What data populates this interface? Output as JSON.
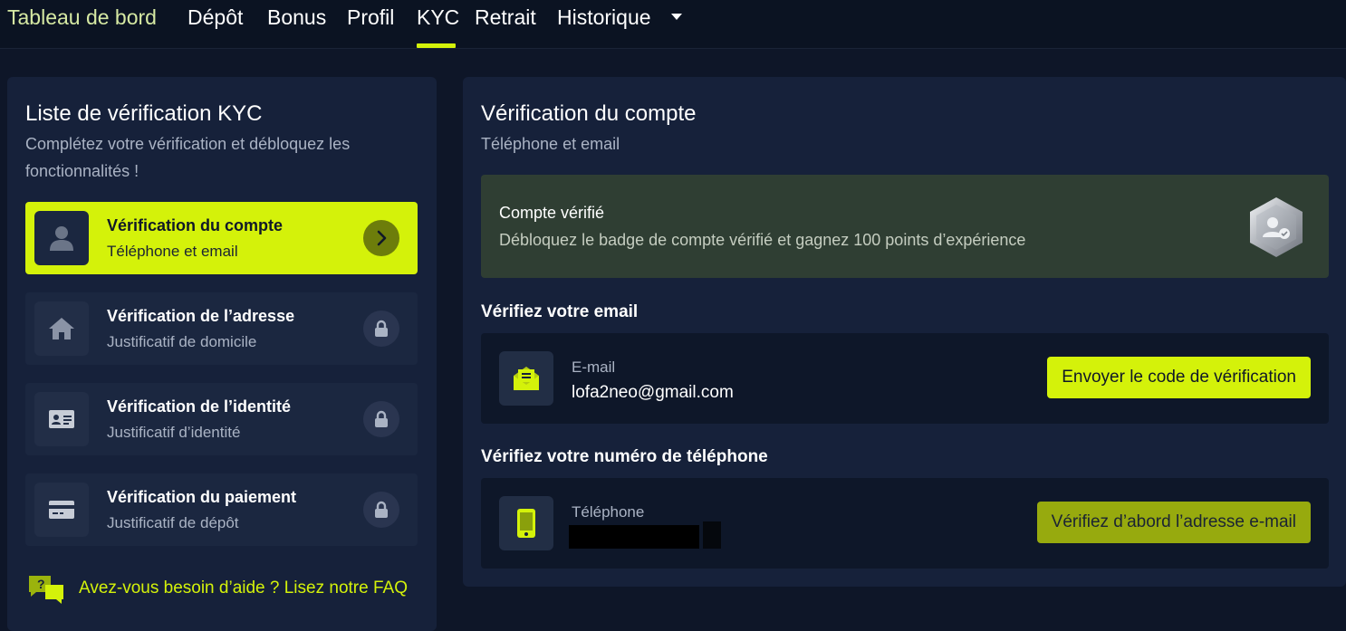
{
  "nav": {
    "items": [
      {
        "label": "Tableau de bord"
      },
      {
        "label": "Dépôt"
      },
      {
        "label": "Bonus"
      },
      {
        "label": "Profil"
      },
      {
        "label": "KYC"
      },
      {
        "label": "Retrait"
      },
      {
        "label": "Historique"
      }
    ],
    "active": "KYC",
    "accent_color": "#d4f20a"
  },
  "checklist": {
    "title": "Liste de vérification KYC",
    "subtitle": "Complétez votre vérification et débloquez les fonctionnalités !",
    "items": [
      {
        "title": "Vérification du compte",
        "desc": "Téléphone et email",
        "icon": "user-icon",
        "state": "active"
      },
      {
        "title": "Vérification de l’adresse",
        "desc": "Justificatif de domicile",
        "icon": "home-icon",
        "state": "locked"
      },
      {
        "title": "Vérification de l’identité",
        "desc": "Justificatif d’identité",
        "icon": "id-card-icon",
        "state": "locked"
      },
      {
        "title": "Vérification du paiement",
        "desc": "Justificatif de dépôt",
        "icon": "credit-card-icon",
        "state": "locked"
      }
    ],
    "help": "Avez-vous besoin d’aide ? Lisez notre FAQ"
  },
  "account": {
    "title": "Vérification du compte",
    "subtitle": "Téléphone et email",
    "banner": {
      "title": "Compte vérifié",
      "desc": "Débloquez le badge de compte vérifié et gagnez 100 points d’expérience"
    },
    "email": {
      "section_title": "Vérifiez votre email",
      "label": "E-mail",
      "value": "lofa2neo@gmail.com",
      "button": "Envoyer le code de vérification"
    },
    "phone": {
      "section_title": "Vérifiez votre numéro de téléphone",
      "label": "Téléphone",
      "value": "",
      "button": "Vérifiez d’abord l’adresse e-mail"
    }
  }
}
